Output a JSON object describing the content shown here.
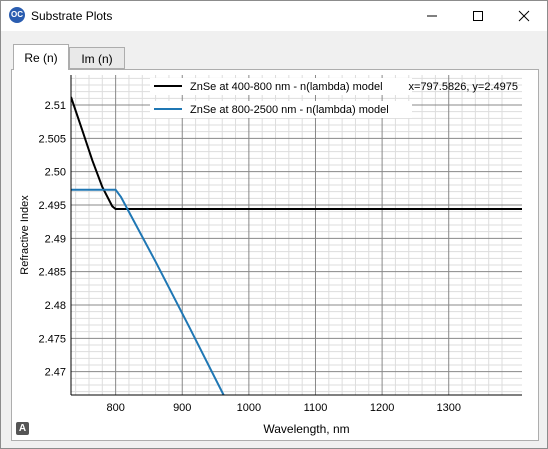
{
  "window": {
    "title": "Substrate Plots",
    "icon_label": "OC",
    "controls": {
      "minimize": "minimize-icon",
      "maximize": "maximize-icon",
      "close": "close-icon"
    }
  },
  "tabs": [
    {
      "label": "Re (n)",
      "active": true
    },
    {
      "label": "Im (n)",
      "active": false
    }
  ],
  "cursor_readout": "x=797.5826, y=2.4975",
  "font_indicator": "A",
  "colors": {
    "series_zns_400_800": "#000000",
    "series_zns_800_2500": "#1f77b4",
    "grid_major": "#888888",
    "grid_minor": "#dddddd"
  },
  "chart_data": {
    "type": "line",
    "title": "",
    "xlabel": "Wavelength, nm",
    "ylabel": "Refractive Index",
    "xlim": [
      733,
      1410
    ],
    "ylim": [
      2.4665,
      2.5145
    ],
    "xticks": [
      800,
      900,
      1000,
      1100,
      1200,
      1300
    ],
    "yticks": [
      2.47,
      2.475,
      2.48,
      2.485,
      2.49,
      2.495,
      2.5,
      2.505,
      2.51
    ],
    "ytick_labels": [
      "2.47",
      "2.475",
      "2.48",
      "2.485",
      "2.49",
      "2.495",
      "2.50",
      "2.505",
      "2.51"
    ],
    "grid": true,
    "legend_position": "top",
    "series": [
      {
        "name": "ZnSe at 400-800 nm - n(lambda) model",
        "x": [
          733,
          750,
          765,
          780,
          795,
          800,
          1410
        ],
        "y": [
          2.5112,
          2.5062,
          2.5017,
          2.4977,
          2.4948,
          2.4944,
          2.4944
        ]
      },
      {
        "name": "ZnSe at 800-2500 nm - n(lambda) model",
        "x": [
          733,
          800,
          808,
          860,
          910,
          962
        ],
        "y": [
          2.4973,
          2.4973,
          2.4962,
          2.4865,
          2.4768,
          2.4665
        ]
      }
    ]
  }
}
